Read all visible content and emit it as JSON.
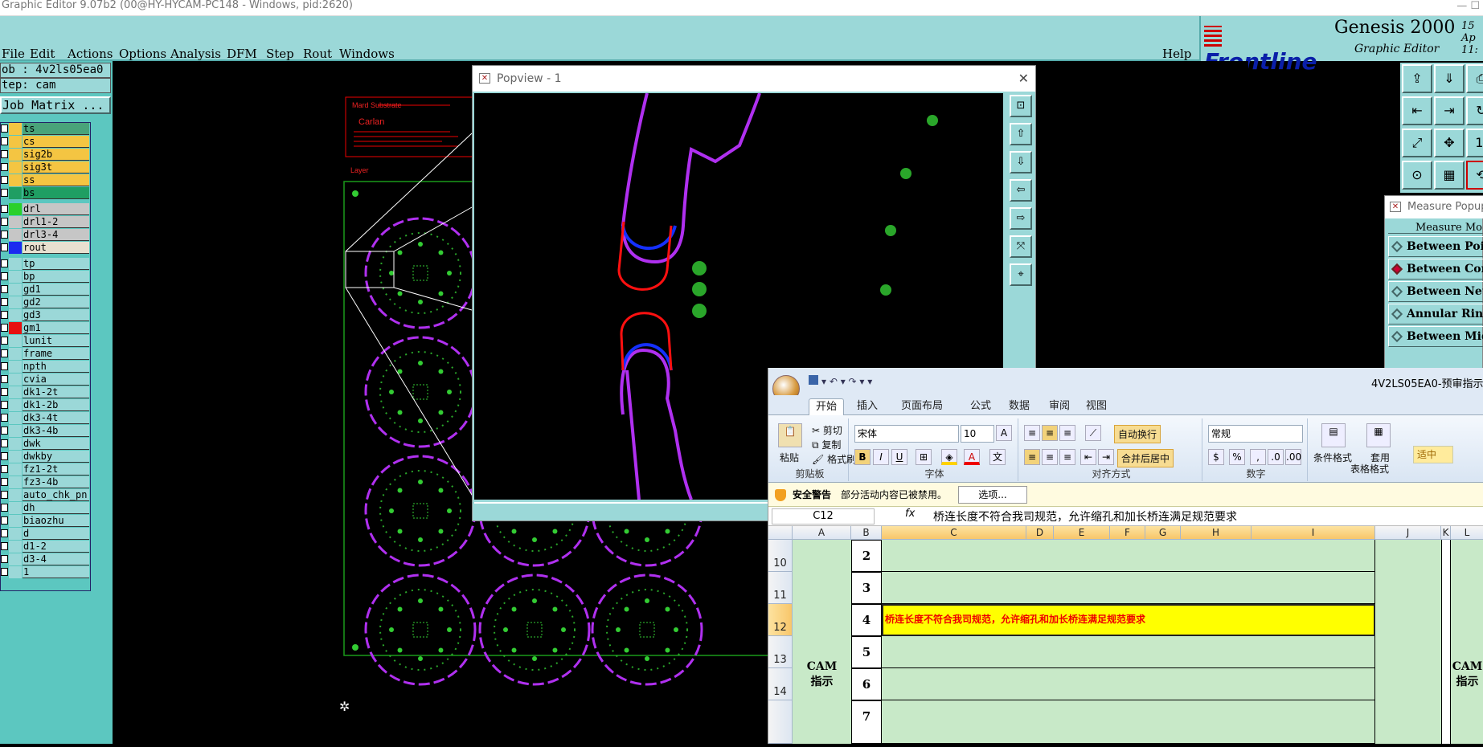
{
  "window": {
    "title": "Graphic Editor 9.07b2 (00@HY-HYCAM-PC148 - Windows, pid:2620)",
    "controls": "— ☐"
  },
  "menu": {
    "items": [
      "File",
      "Edit",
      "Actions",
      "Options",
      "Analysis",
      "DFM",
      "Step",
      "Rout",
      "Windows"
    ],
    "help": "Help"
  },
  "brand": {
    "logo": "Frontline",
    "title": "Genesis 2000",
    "subtitle": "Graphic Editor",
    "date_line1": "15 Ap",
    "date_line2": "11:"
  },
  "job": {
    "job_label": "ob : 4v2ls05ea0",
    "step_label": "tep: cam",
    "matrix_button": "Job Matrix ..."
  },
  "layers": [
    {
      "name": "ts",
      "color": "#f4c542",
      "bg": "#49a37a"
    },
    {
      "name": "cs",
      "color": "#f4c542",
      "bg": "#f4c542"
    },
    {
      "name": "sig2b",
      "color": "#f4c542",
      "bg": "#f4c542"
    },
    {
      "name": "sig3t",
      "color": "#f4c542",
      "bg": "#f4c542"
    },
    {
      "name": "ss",
      "color": "#f4c542",
      "bg": "#f4c542"
    },
    {
      "name": "bs",
      "color": "#1f9e63",
      "bg": "#1f9e63"
    },
    {
      "name": "drl",
      "color": "#2bd02b",
      "bg": "#c6c6c6"
    },
    {
      "name": "drl1-2",
      "color": "#c6c6c6",
      "bg": "#c6c6c6"
    },
    {
      "name": "drl3-4",
      "color": "#c6c6c6",
      "bg": "#c6c6c6"
    },
    {
      "name": "rout",
      "color": "#1b2af0",
      "bg": "#e8e0d0"
    },
    {
      "name": "tp",
      "color": "#9bd8d8",
      "bg": "#9bd8d8"
    },
    {
      "name": "bp",
      "color": "#9bd8d8",
      "bg": "#9bd8d8"
    },
    {
      "name": "gd1",
      "color": "#9bd8d8",
      "bg": "#9bd8d8"
    },
    {
      "name": "gd2",
      "color": "#9bd8d8",
      "bg": "#9bd8d8"
    },
    {
      "name": "gd3",
      "color": "#9bd8d8",
      "bg": "#9bd8d8"
    },
    {
      "name": "gm1",
      "color": "#e81010",
      "bg": "#9bd8d8"
    },
    {
      "name": "lunit",
      "color": "#9bd8d8",
      "bg": "#9bd8d8"
    },
    {
      "name": "frame",
      "color": "#9bd8d8",
      "bg": "#9bd8d8"
    },
    {
      "name": "npth",
      "color": "#9bd8d8",
      "bg": "#9bd8d8"
    },
    {
      "name": "cvia",
      "color": "#9bd8d8",
      "bg": "#9bd8d8"
    },
    {
      "name": "dk1-2t",
      "color": "#9bd8d8",
      "bg": "#9bd8d8"
    },
    {
      "name": "dk1-2b",
      "color": "#9bd8d8",
      "bg": "#9bd8d8"
    },
    {
      "name": "dk3-4t",
      "color": "#9bd8d8",
      "bg": "#9bd8d8"
    },
    {
      "name": "dk3-4b",
      "color": "#9bd8d8",
      "bg": "#9bd8d8"
    },
    {
      "name": "dwk",
      "color": "#9bd8d8",
      "bg": "#9bd8d8"
    },
    {
      "name": "dwkby",
      "color": "#9bd8d8",
      "bg": "#9bd8d8"
    },
    {
      "name": "fz1-2t",
      "color": "#9bd8d8",
      "bg": "#9bd8d8"
    },
    {
      "name": "fz3-4b",
      "color": "#9bd8d8",
      "bg": "#9bd8d8"
    },
    {
      "name": "auto_chk_pn",
      "color": "#9bd8d8",
      "bg": "#9bd8d8"
    },
    {
      "name": "dh",
      "color": "#9bd8d8",
      "bg": "#9bd8d8"
    },
    {
      "name": "biaozhu",
      "color": "#9bd8d8",
      "bg": "#9bd8d8"
    },
    {
      "name": "d",
      "color": "#9bd8d8",
      "bg": "#9bd8d8"
    },
    {
      "name": "d1-2",
      "color": "#9bd8d8",
      "bg": "#9bd8d8"
    },
    {
      "name": "d3-4",
      "color": "#9bd8d8",
      "bg": "#9bd8d8"
    },
    {
      "name": "1",
      "color": "#9bd8d8",
      "bg": "#9bd8d8"
    }
  ],
  "drawing": {
    "header_line1": "Mard Substrate",
    "header_line2": "Carlan",
    "layer_tag": "Layer"
  },
  "popview": {
    "title": "Popview - 1",
    "close": "Close",
    "close_x": "✕"
  },
  "measure": {
    "title": "Measure Popup",
    "heading": "Measure Mo",
    "options": [
      "Between Poi",
      "Between Con",
      "Between Net",
      "Annular Rin",
      "Between Mid"
    ],
    "selected_index": 1
  },
  "excel": {
    "doc_title": "4V2LS05EA0-预审指示 [",
    "qat": "▾ ↶ ▾ ↷ ▾ ▾",
    "tabs": [
      "开始",
      "插入",
      "页面布局",
      "公式",
      "数据",
      "审阅",
      "视图"
    ],
    "clipboard": {
      "paste": "粘贴",
      "cut": "剪切",
      "copy": "复制",
      "format_painter": "格式刷",
      "label": "剪贴板"
    },
    "font": {
      "name": "宋体",
      "size": "10",
      "label": "字体",
      "bold": "B",
      "italic": "I",
      "underline": "U"
    },
    "alignment": {
      "wrap": "自动换行",
      "merge": "合并后居中",
      "label": "对齐方式"
    },
    "number": {
      "format": "常规",
      "label": "数字",
      "percent": "%"
    },
    "styles": {
      "conditional": "条件格式",
      "table": "套用",
      "table2": "表格格式",
      "style_mid": "适中"
    },
    "security": {
      "label": "安全警告",
      "message": "部分活动内容已被禁用。",
      "button": "选项..."
    },
    "cell_ref": "C12",
    "fx": "fx",
    "formula": "桥连长度不符合我司规范，允许缩孔和加长桥连满足规范要求",
    "columns": [
      "A",
      "B",
      "C",
      "D",
      "E",
      "F",
      "G",
      "H",
      "I",
      "J",
      "K",
      "L"
    ],
    "rows": [
      {
        "num": "10",
        "b": "2",
        "c": ""
      },
      {
        "num": "11",
        "b": "3",
        "c": ""
      },
      {
        "num": "12",
        "b": "4",
        "c": "桥连长度不符合我司规范，允许缩孔和加长桥连满足规范要求"
      },
      {
        "num": "13",
        "b": "5",
        "c": ""
      },
      {
        "num": "14",
        "b": "6",
        "c": ""
      },
      {
        "num": "",
        "b": "7",
        "c": ""
      }
    ],
    "cam_label_1": "CAM",
    "cam_label_2": "指示",
    "cam_label_r1": "CAM",
    "cam_label_r2": "指示"
  }
}
